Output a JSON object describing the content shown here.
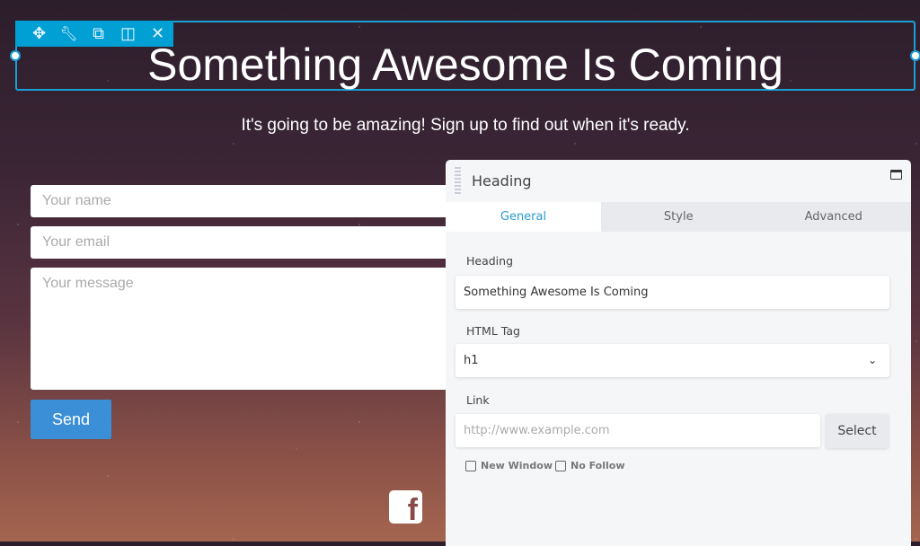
{
  "toolbar": {
    "icons": [
      "move-icon",
      "wrench-icon",
      "duplicate-icon",
      "columns-icon",
      "close-icon"
    ],
    "glyphs": [
      "✥",
      "🔧",
      "⧉",
      "◫",
      "✕"
    ]
  },
  "hero": {
    "title": "Something Awesome Is Coming",
    "subtitle": "It's going to be amazing! Sign up to find out when it's ready."
  },
  "form": {
    "name_placeholder": "Your name",
    "email_placeholder": "Your email",
    "message_placeholder": "Your message",
    "send_label": "Send"
  },
  "social": {
    "facebook": "f"
  },
  "panel": {
    "title": "Heading",
    "tabs": [
      {
        "label": "General",
        "active": true
      },
      {
        "label": "Style"
      },
      {
        "label": "Advanced"
      }
    ],
    "heading_label": "Heading",
    "heading_value": "Something Awesome Is Coming",
    "tag_label": "HTML Tag",
    "tag_value": "h1",
    "link_label": "Link",
    "link_placeholder": "http://www.example.com",
    "select_label": "Select",
    "new_window": "New Window",
    "no_follow": "No Follow"
  },
  "colors": {
    "accent": "#009fd4",
    "send": "#3a8fd6"
  }
}
